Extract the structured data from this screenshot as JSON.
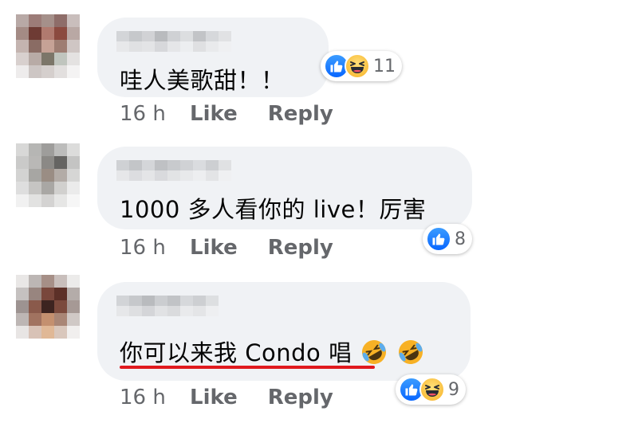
{
  "colors": {
    "bubble": "#f0f2f5",
    "text": "#050505",
    "meta": "#65676b",
    "like_blue": "#0866ff",
    "haha_yellow": "#f7b125",
    "underline_red": "#e0191e"
  },
  "comments": [
    {
      "text": "哇人美歌甜！！",
      "reactions": {
        "icons": [
          "like-icon",
          "haha-icon"
        ],
        "count": "11"
      },
      "time": "16 h",
      "like_label": "Like",
      "reply_label": "Reply"
    },
    {
      "text": "1000 多人看你的 live！厉害",
      "reactions": {
        "icons": [
          "like-icon"
        ],
        "count": "8"
      },
      "time": "16 h",
      "like_label": "Like",
      "reply_label": "Reply"
    },
    {
      "text": "你可以来我 Condo 唱",
      "trailing_emoji": [
        "rolling-on-floor-laughing-icon",
        "rolling-on-floor-laughing-icon"
      ],
      "reactions": {
        "icons": [
          "like-icon",
          "haha-icon"
        ],
        "count": "9"
      },
      "time": "16 h",
      "like_label": "Like",
      "reply_label": "Reply"
    }
  ]
}
